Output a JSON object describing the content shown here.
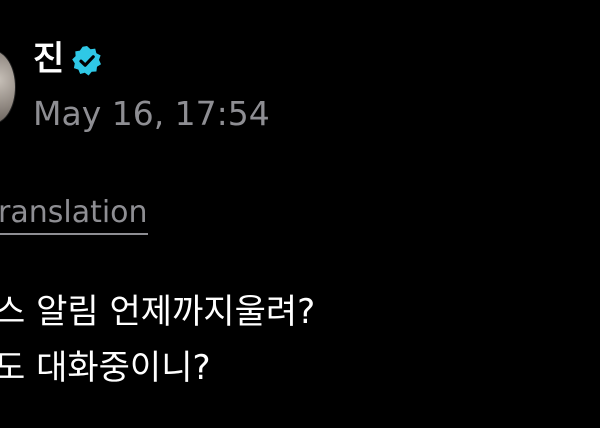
{
  "post": {
    "author_name": "진",
    "verified": true,
    "timestamp": "May 16, 17:54",
    "translation_label": "ranslation",
    "lines": [
      "스 알림 언제까지울려?",
      "도 대화중이니?"
    ]
  },
  "icons": {
    "verified": "verified-badge-icon",
    "avatar": "profile-avatar"
  },
  "colors": {
    "background": "#000000",
    "text_primary": "#ffffff",
    "text_secondary": "#8e8e93",
    "verified_badge": "#2fc8e6"
  }
}
